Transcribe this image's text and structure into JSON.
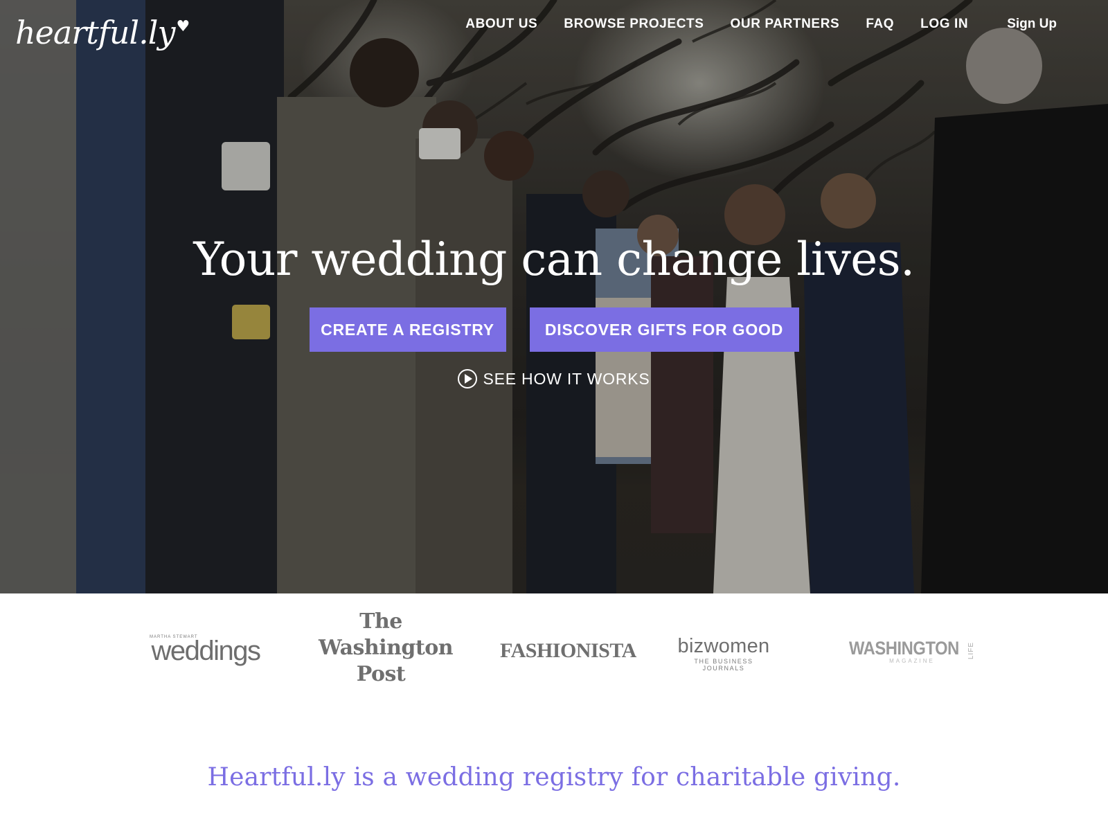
{
  "brand": {
    "logo_text": "heartful.ly",
    "accent_color": "#7b6ee3"
  },
  "nav": {
    "items": [
      {
        "label": "ABOUT US"
      },
      {
        "label": "BROWSE PROJECTS"
      },
      {
        "label": "OUR PARTNERS"
      },
      {
        "label": "FAQ"
      },
      {
        "label": "LOG IN"
      }
    ],
    "signup_label": "Sign Up"
  },
  "hero": {
    "background": "wedding-ceremony-photo",
    "headline": "Your wedding can change lives.",
    "primary_cta": "CREATE A REGISTRY",
    "secondary_cta": "DISCOVER GIFTS FOR GOOD",
    "how_it_works": "SEE HOW IT WORKS"
  },
  "press": {
    "weddings": {
      "small": "MARTHA STEWART",
      "big": "weddings"
    },
    "washington_post": {
      "line1": "The",
      "line2": "Washington",
      "line3": "Post"
    },
    "fashionista": "FASHIONISTA",
    "bizwomen": {
      "big": "bizwomen",
      "small": "THE BUSINESS JOURNALS"
    },
    "washington_life": {
      "big": "WASHINGTON",
      "side": "LIFE",
      "small": "MAGAZINE"
    }
  },
  "tagline": "Heartful.ly is a wedding registry for charitable giving."
}
